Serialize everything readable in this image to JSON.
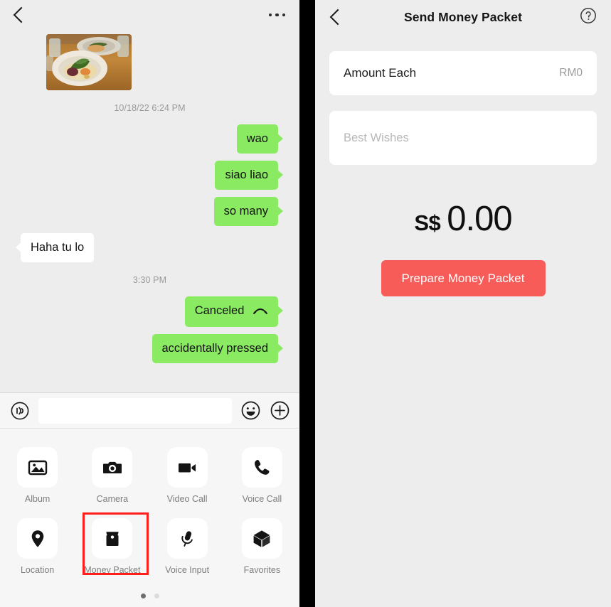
{
  "colors": {
    "bubble_out": "#8AEA62",
    "bubble_in": "#FFFFFF",
    "panel_bg": "#EDEDED",
    "accent_red": "#F85C58",
    "highlight_red": "#FF1D1D"
  },
  "chat": {
    "header": {
      "back_icon": "back-chevron-icon",
      "more_icon": "more-options-icon"
    },
    "photo_message": {
      "icon": "photo-thumbnail",
      "alt": "Photo of plated food on a wooden table"
    },
    "timestamps": [
      "10/18/22 6:24 PM",
      "3:30 PM"
    ],
    "messages": [
      {
        "text": "wao",
        "side": "out"
      },
      {
        "text": "siao liao",
        "side": "out"
      },
      {
        "text": "so many",
        "side": "out"
      },
      {
        "text": "Haha tu lo",
        "side": "in"
      },
      {
        "text": "Canceled",
        "side": "out",
        "icon": "call-ended-icon"
      },
      {
        "text": "accidentally pressed",
        "side": "out"
      }
    ],
    "input_bar": {
      "voice_icon": "voice-wave-icon",
      "input_value": "",
      "input_placeholder": "",
      "emoji_icon": "smiley-face-icon",
      "plus_icon": "plus-circle-icon"
    },
    "attachments": {
      "items": [
        {
          "label": "Album",
          "icon": "album-icon",
          "highlighted": false
        },
        {
          "label": "Camera",
          "icon": "camera-icon",
          "highlighted": false
        },
        {
          "label": "Video Call",
          "icon": "video-call-icon",
          "highlighted": false
        },
        {
          "label": "Voice Call",
          "icon": "voice-call-icon",
          "highlighted": false
        },
        {
          "label": "Location",
          "icon": "location-pin-icon",
          "highlighted": false
        },
        {
          "label": "Money Packet",
          "icon": "money-packet-icon",
          "highlighted": true
        },
        {
          "label": "Voice Input",
          "icon": "microphone-icon",
          "highlighted": false
        },
        {
          "label": "Favorites",
          "icon": "box-cube-icon",
          "highlighted": false
        }
      ],
      "page_dots": {
        "count": 2,
        "active_index": 0
      }
    }
  },
  "money_packet": {
    "header": {
      "back_icon": "back-chevron-icon",
      "title": "Send Money Packet",
      "help_icon": "help-circle-icon"
    },
    "amount_row": {
      "label": "Amount Each",
      "value": "RM0"
    },
    "wishes_row": {
      "value": "",
      "placeholder": "Best Wishes"
    },
    "total": {
      "currency": "S$",
      "amount": "0.00"
    },
    "submit_button": "Prepare Money Packet"
  }
}
